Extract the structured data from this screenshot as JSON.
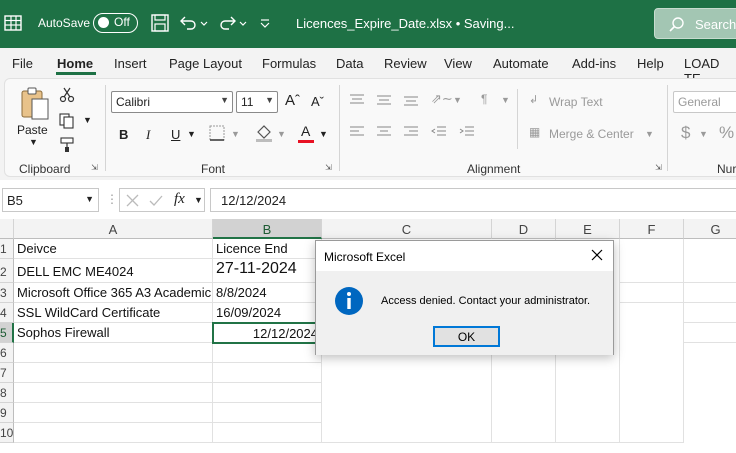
{
  "titlebar": {
    "autosave_label": "AutoSave",
    "toggle_label": "Off",
    "filename": "Licences_Expire_Date.xlsx • Saving...",
    "search_placeholder": "Search"
  },
  "menu": [
    "File",
    "Home",
    "Insert",
    "Page Layout",
    "Formulas",
    "Data",
    "Review",
    "View",
    "Automate",
    "Add-ins",
    "Help",
    "LOAD TE"
  ],
  "ribbon": {
    "paste_label": "Paste",
    "clipboard_label": "Clipboard",
    "font_name": "Calibri",
    "font_size": "11",
    "font_label": "Font",
    "alignment_label": "Alignment",
    "wrap_text": "Wrap Text",
    "merge_center": "Merge & Center",
    "number_format": "General",
    "number_label": "Nur",
    "bold": "B",
    "italic": "I",
    "underline": "U",
    "currency": "$",
    "percent": "%"
  },
  "formula_bar": {
    "name_box": "B5",
    "fx": "fx",
    "value": "12/12/2024"
  },
  "columns": [
    "A",
    "B",
    "C",
    "D",
    "E",
    "F",
    "G"
  ],
  "rows": [
    "1",
    "2",
    "3",
    "4",
    "5",
    "6",
    "7",
    "8",
    "9",
    "10"
  ],
  "cells": {
    "A1": "Deivce",
    "B1": "Licence End",
    "A2": "DELL EMC ME4024",
    "B2": "27-11-2024",
    "A3": "Microsoft Office 365 A3 Academic",
    "B3": "8/8/2024",
    "A4": "SSL WildCard Certificate",
    "B4": "16/09/2024",
    "A5": "Sophos Firewall",
    "B5": "12/12/2024"
  },
  "dialog": {
    "title": "Microsoft Excel",
    "message": "Access denied. Contact your administrator.",
    "ok_label": "OK"
  },
  "colors": {
    "excel_green": "#1e7145",
    "selection_green": "#217346",
    "info_blue": "#0067c0",
    "button_focus": "#0078d7"
  }
}
